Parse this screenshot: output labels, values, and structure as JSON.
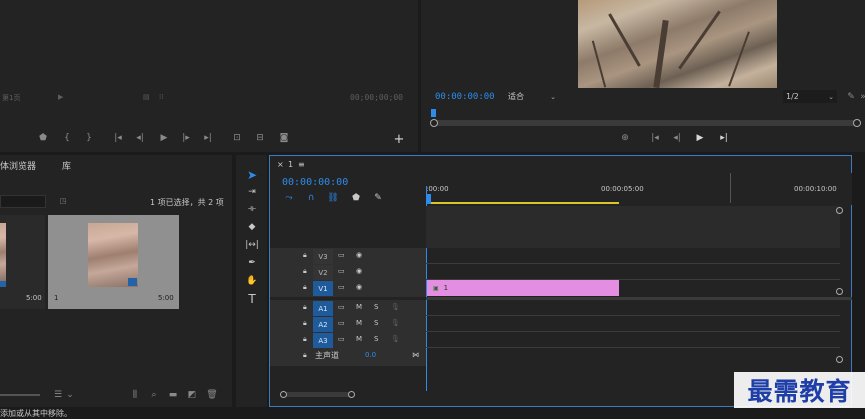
{
  "source_monitor": {
    "timecode": "00;00;00;00",
    "faded_label": "第1页"
  },
  "program_monitor": {
    "timecode": "00:00:00:00",
    "fit_label": "适合",
    "resolution": "1/2"
  },
  "project_panel": {
    "tabs": [
      "体浏览器",
      "库"
    ],
    "selection_status": "1 项已选择，共 2 项",
    "items": [
      {
        "name": "",
        "duration": "5:00"
      },
      {
        "name": "1",
        "duration": "5:00"
      }
    ]
  },
  "timeline": {
    "sequence_name": "1",
    "timecode": "00:00:00:00",
    "ruler": [
      ":00:00",
      "00:00:05:00",
      "00:00:10:00"
    ],
    "video_tracks": [
      "V3",
      "V2",
      "V1"
    ],
    "audio_tracks": [
      "A1",
      "A2",
      "A3"
    ],
    "master_label": "主声道",
    "master_value": "0.0",
    "clip_label": "1",
    "clip_color": "#e38ee0",
    "audio_controls": {
      "mute": "M",
      "solo": "S"
    }
  },
  "tools": [
    "selection-tool",
    "track-select-tool",
    "ripple-edit-tool",
    "razor-tool",
    "slip-tool",
    "pen-tool",
    "hand-tool",
    "type-tool"
  ],
  "status_bar": {
    "text": "添加或从其中移除。"
  },
  "watermark": {
    "text": "最需教育"
  },
  "colors": {
    "accent": "#2d8ceb",
    "panel_border": "#3c7bbf",
    "clip": "#e38ee0",
    "workarea": "#d8c62a"
  }
}
